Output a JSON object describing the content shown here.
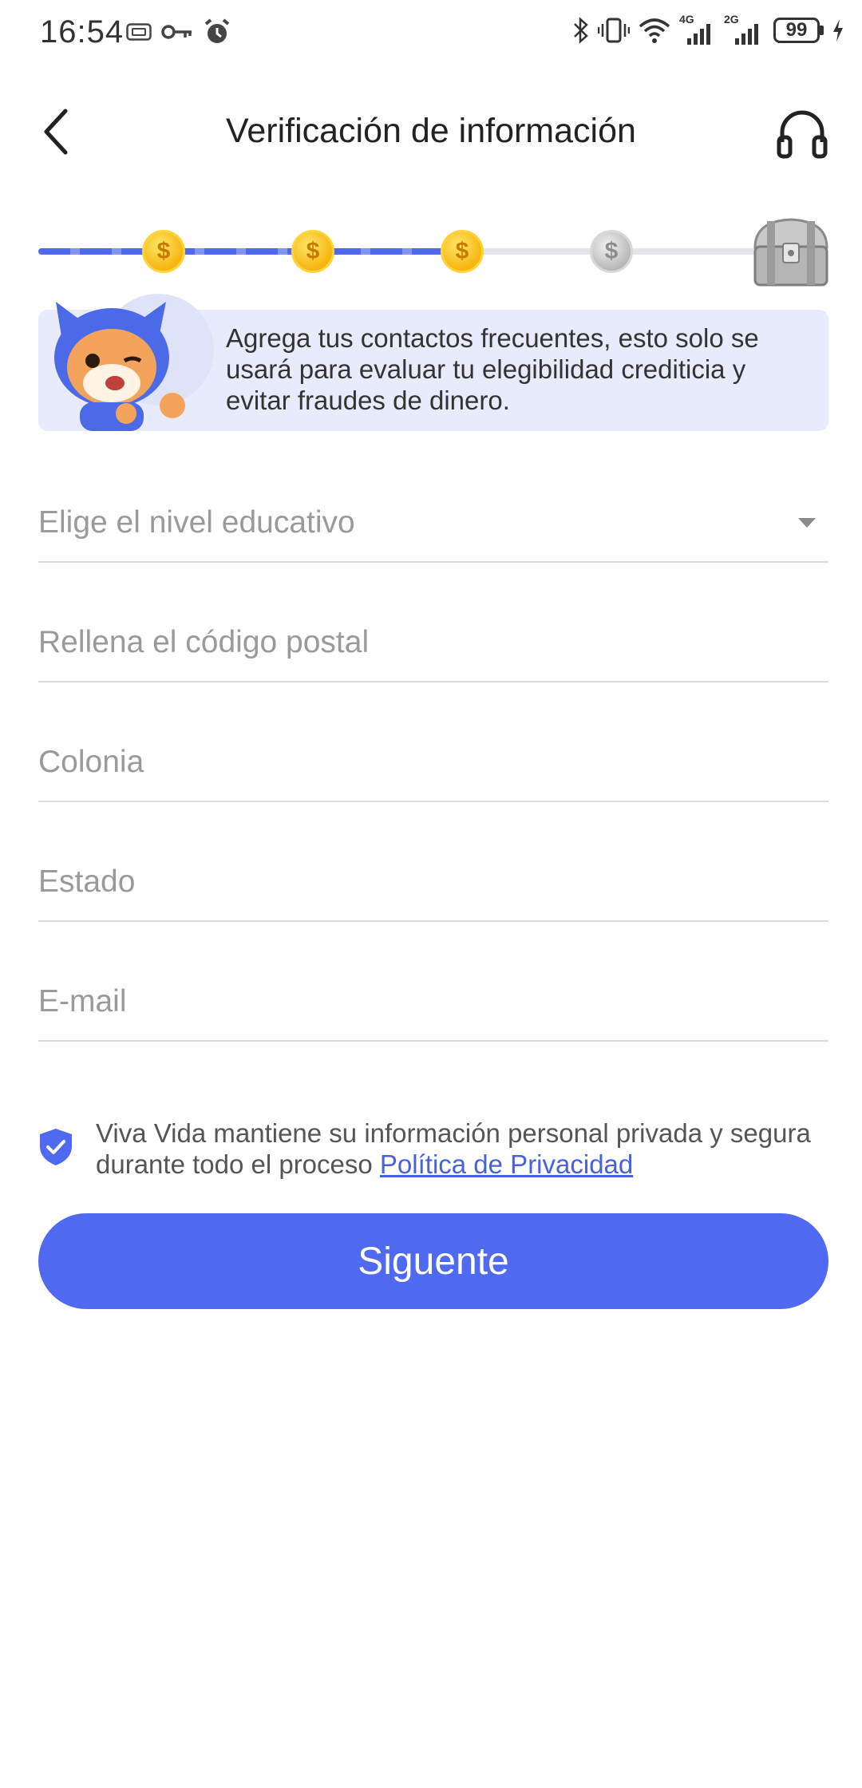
{
  "status_bar": {
    "time": "16:54",
    "battery": "99",
    "left_icons": [
      "sim-card-icon",
      "key-icon",
      "alarm-icon"
    ],
    "right_icons": [
      "bluetooth-icon",
      "vibrate-icon",
      "wifi-icon",
      "signal-4g-icon",
      "signal-2g-icon",
      "battery-icon",
      "charging-icon"
    ],
    "network_labels": [
      "4G",
      "2G"
    ]
  },
  "header": {
    "title": "Verificación de información",
    "back_icon": "chevron-left-icon",
    "support_icon": "headphones-icon"
  },
  "progress": {
    "steps_total": 4,
    "steps_completed": 3,
    "coin_symbol": "$",
    "reward_icon": "treasure-chest-icon"
  },
  "banner": {
    "text": "Agrega tus contactos frecuentes, esto solo se usará para evaluar tu elegibilidad crediticia y evitar fraudes de dinero."
  },
  "form": {
    "education": {
      "placeholder": "Elige el nivel educativo"
    },
    "postal_code": {
      "placeholder": "Rellena el código postal"
    },
    "colonia": {
      "placeholder": "Colonia"
    },
    "estado": {
      "placeholder": "Estado"
    },
    "email": {
      "placeholder": "E-mail"
    }
  },
  "privacy": {
    "text": "Viva Vida mantiene su información personal privada y segura durante todo el proceso",
    "link": "Política de Privacidad"
  },
  "next_button": {
    "label": "Siguente"
  },
  "colors": {
    "accent": "#4f69f0",
    "banner_bg": "#e8ebfb",
    "link": "#4861dd",
    "placeholder": "#9a9a9a"
  }
}
